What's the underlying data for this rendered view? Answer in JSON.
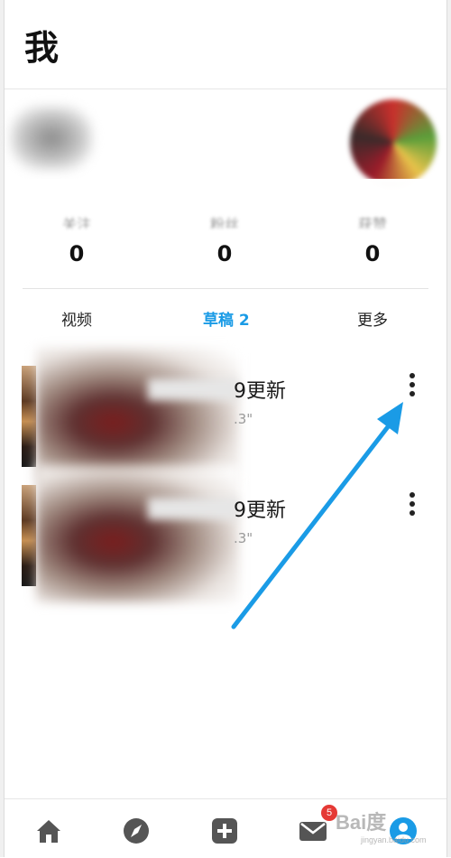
{
  "header": {
    "title": "我"
  },
  "stats": [
    {
      "label": "关注",
      "value": "0"
    },
    {
      "label": "粉丝",
      "value": "0"
    },
    {
      "label": "获赞",
      "value": "0"
    }
  ],
  "tabs": [
    {
      "label": "视频",
      "active": false
    },
    {
      "label": "草稿 2",
      "active": true
    },
    {
      "label": "更多",
      "active": false
    }
  ],
  "drafts": [
    {
      "title": "9更新",
      "duration": ".3\""
    },
    {
      "title": "9更新",
      "duration": ".3\""
    }
  ],
  "bottom_nav": {
    "items": [
      "home-icon",
      "compass-icon",
      "add-icon",
      "mail-icon",
      "profile-icon"
    ],
    "message_badge": "5"
  },
  "watermark": {
    "main": "Bai度",
    "sub": "jingyan.baidu.com"
  },
  "colors": {
    "accent": "#1a9be6",
    "badge": "#e53935",
    "arrow": "#1a9be6"
  }
}
